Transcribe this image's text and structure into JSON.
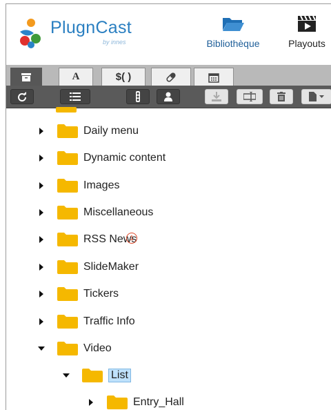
{
  "brand": {
    "name": "PlugnCast",
    "by": "by innes"
  },
  "nav": [
    {
      "label": "Bibliothèque",
      "icon": "folder-open-icon"
    },
    {
      "label": "Playouts",
      "icon": "clapperboard-icon"
    }
  ],
  "tabs": [
    {
      "icon": "archive-icon",
      "text": ""
    },
    {
      "icon": "font-icon",
      "text": "A"
    },
    {
      "icon": "dollar-icon",
      "text": "$( )"
    },
    {
      "icon": "pill-icon",
      "text": ""
    },
    {
      "icon": "calendar-icon",
      "text": ""
    }
  ],
  "toolbar": [
    "refresh-icon",
    "list-icon",
    "traffic-light-icon",
    "user-icon",
    "download-icon",
    "rename-icon",
    "trash-icon",
    "new-file-dropdown-icon"
  ],
  "tree": {
    "items": [
      {
        "label": "Daily menu",
        "expanded": false
      },
      {
        "label": "Dynamic content",
        "expanded": false
      },
      {
        "label": "Images",
        "expanded": false
      },
      {
        "label": "Miscellaneous",
        "expanded": false
      },
      {
        "label": "RSS News",
        "expanded": false
      },
      {
        "label": "SlideMaker",
        "expanded": false
      },
      {
        "label": "Tickers",
        "expanded": false
      },
      {
        "label": "Traffic Info",
        "expanded": false
      },
      {
        "label": "Video",
        "expanded": true
      },
      {
        "label": "List",
        "expanded": true,
        "selected": true
      },
      {
        "label": "Entry_Hall",
        "expanded": false
      }
    ],
    "annotation": "1"
  },
  "colors": {
    "brand_blue": "#2a7fc1",
    "folder_yellow": "#f5b800",
    "selection": "#bfe1fb",
    "toolbar": "#5a5a5a",
    "annotation_red": "#e04a2a"
  }
}
